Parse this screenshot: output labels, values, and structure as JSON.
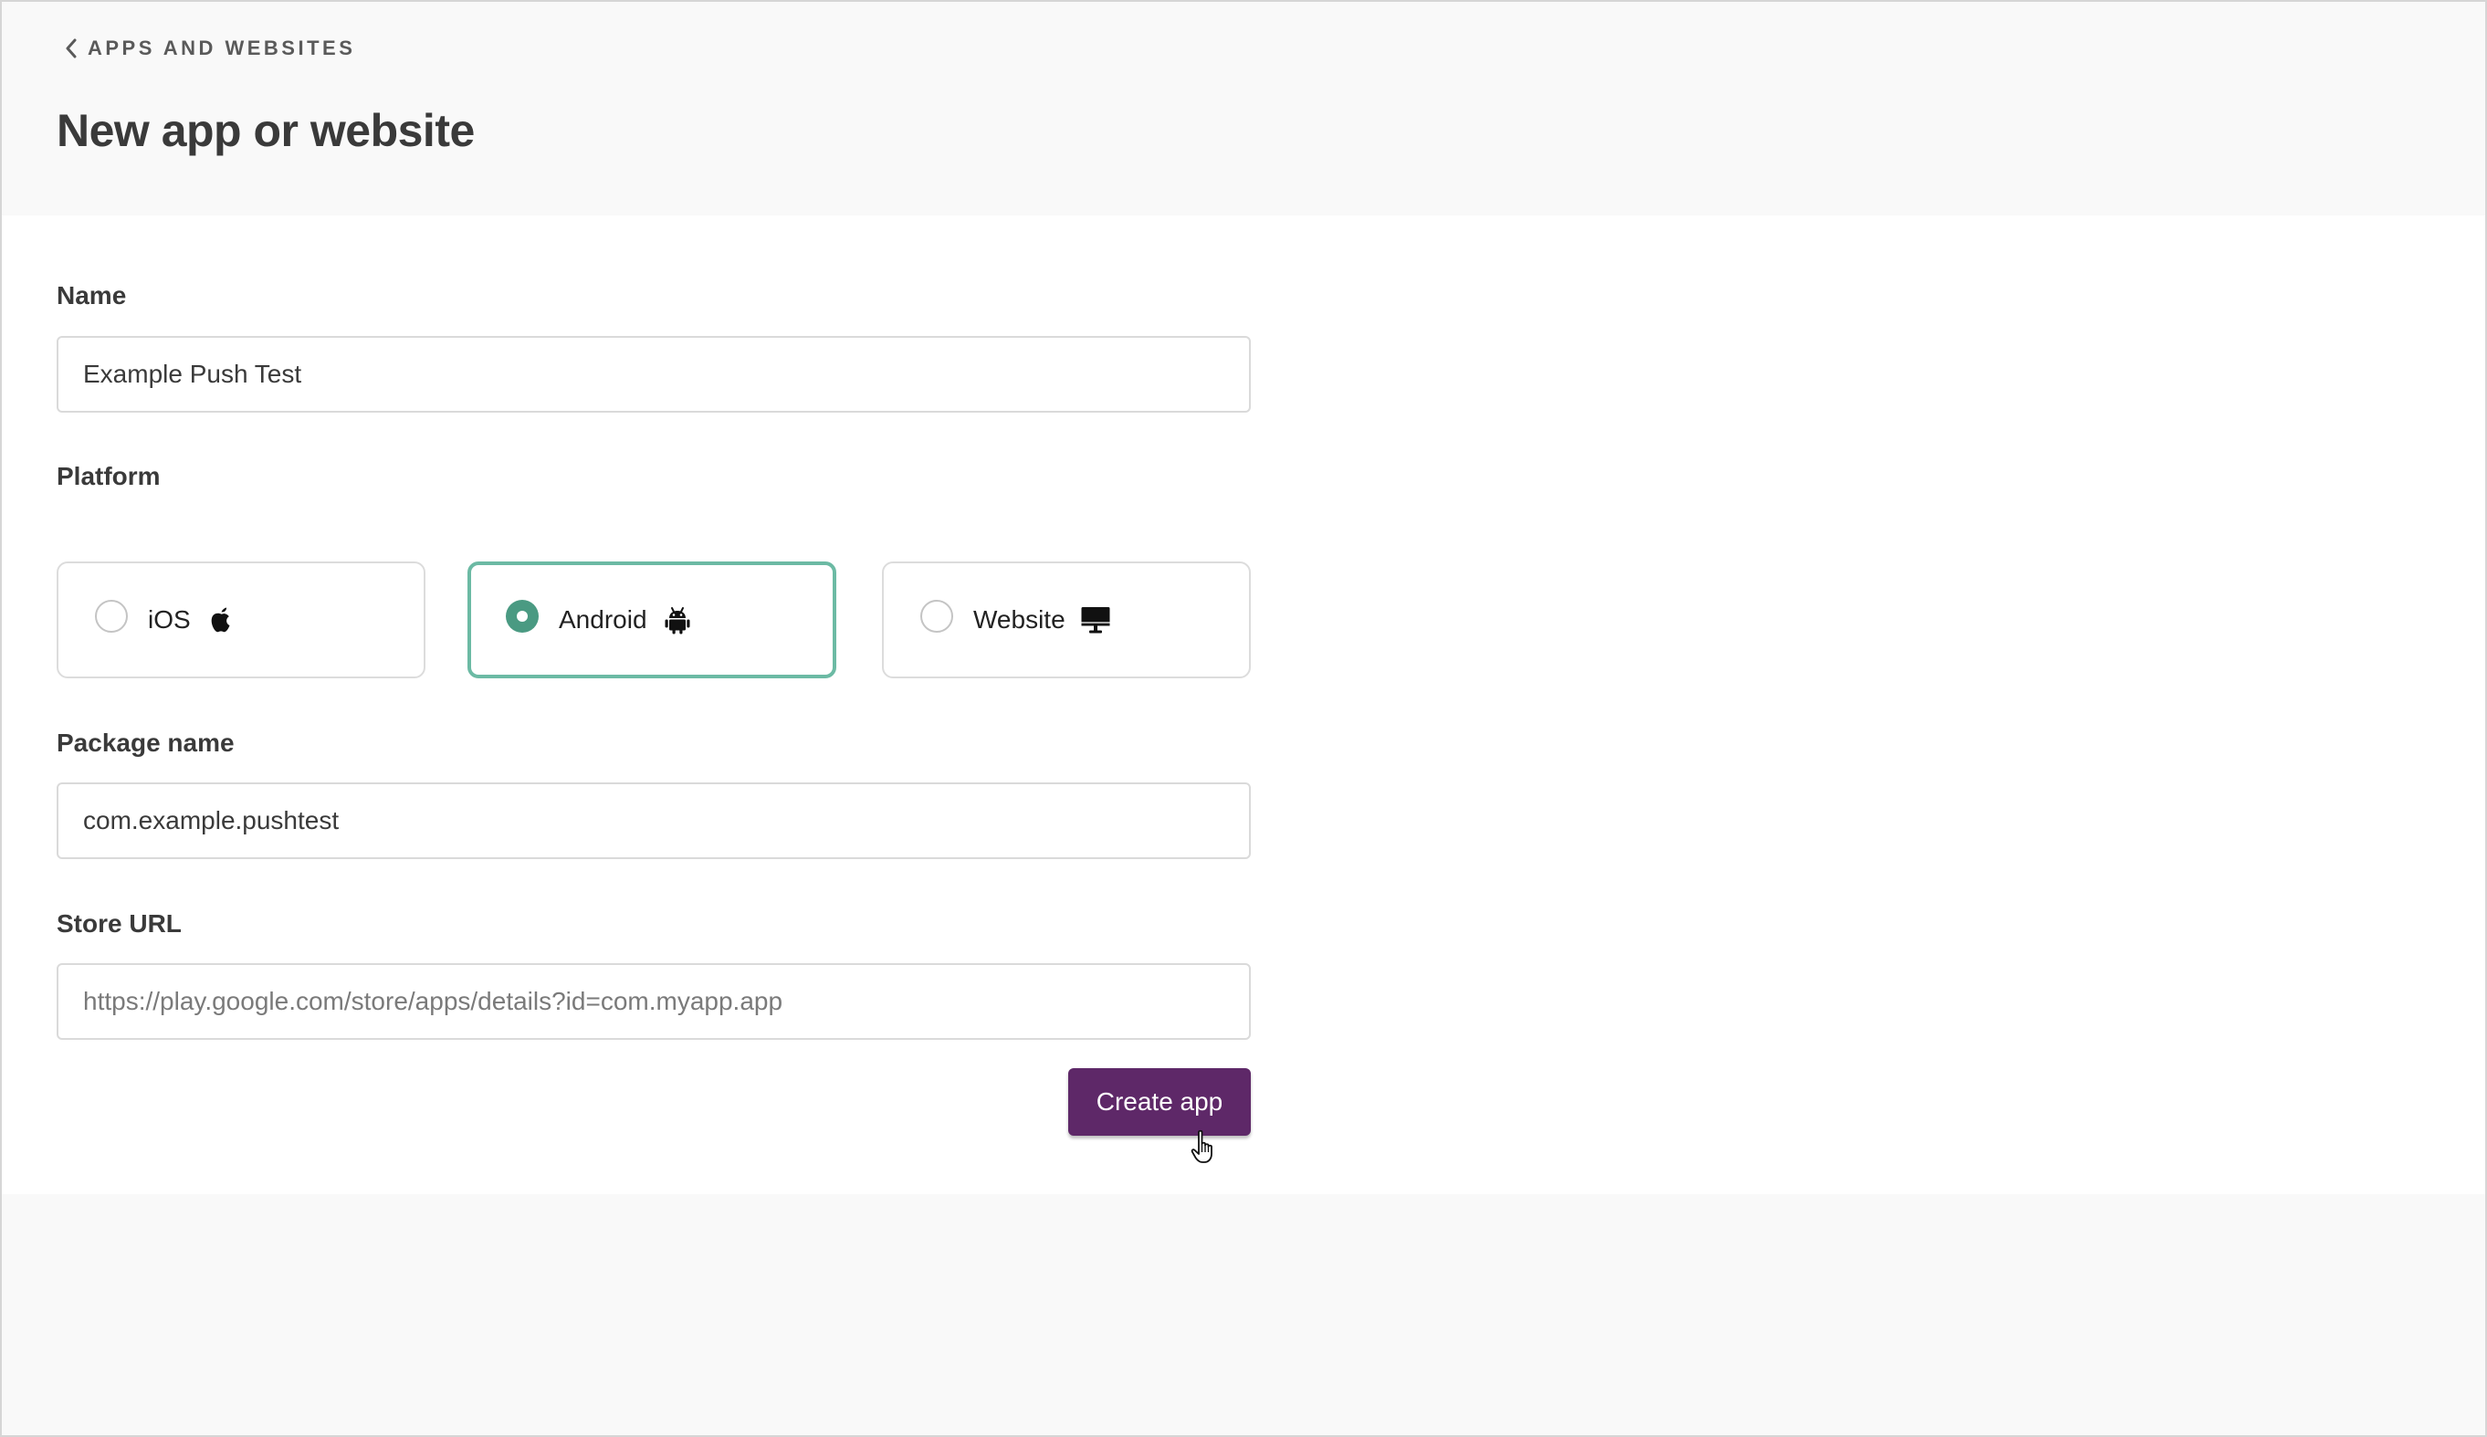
{
  "header": {
    "back_label": "APPS AND WEBSITES",
    "title": "New app or website"
  },
  "form": {
    "name": {
      "label": "Name",
      "value": "Example Push Test",
      "placeholder": ""
    },
    "platform": {
      "label": "Platform",
      "selected": "Android",
      "options": [
        {
          "label": "iOS",
          "icon": "apple-icon",
          "checked": false
        },
        {
          "label": "Android",
          "icon": "android-icon",
          "checked": true
        },
        {
          "label": "Website",
          "icon": "desktop-monitor-icon",
          "checked": false
        }
      ]
    },
    "package_name": {
      "label": "Package name",
      "value": "com.example.pushtest",
      "placeholder": ""
    },
    "store_url": {
      "label": "Store URL",
      "value": "",
      "placeholder": "https://play.google.com/store/apps/details?id=com.myapp.app"
    },
    "submit_label": "Create app"
  },
  "colors": {
    "accent_selected_border": "#6cbaa4",
    "radio_checked": "#4a9a82",
    "primary_button": "#5e2868",
    "page_background": "#f9f9f9",
    "panel_background": "#ffffff"
  }
}
